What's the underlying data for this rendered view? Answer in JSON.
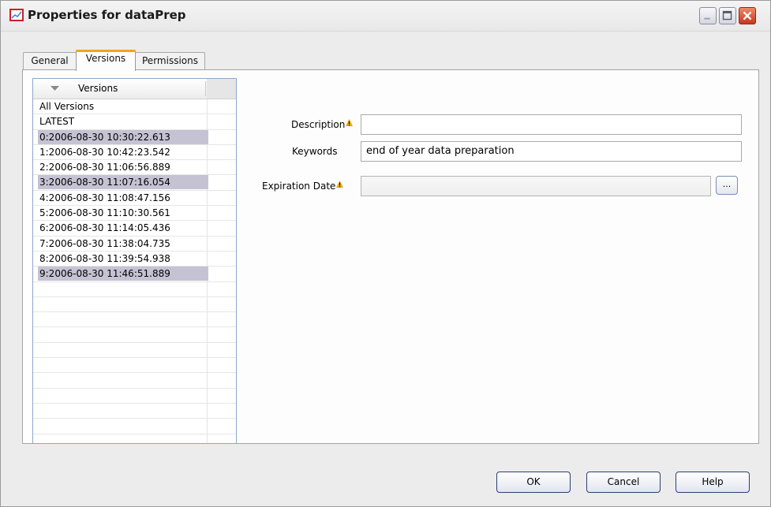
{
  "window": {
    "title": "Properties for dataPrep",
    "controls": {
      "minimize": "minimize-icon",
      "maximize": "maximize-icon",
      "close": "close-icon"
    }
  },
  "tabs": [
    {
      "label": "General"
    },
    {
      "label": "Versions",
      "active": true
    },
    {
      "label": "Permissions"
    }
  ],
  "versions_list": {
    "header": "Versions",
    "rows": [
      {
        "label": "All Versions",
        "selected": false
      },
      {
        "label": "LATEST",
        "selected": false
      },
      {
        "label": "0:2006-08-30 10:30:22.613",
        "selected": true
      },
      {
        "label": "1:2006-08-30 10:42:23.542",
        "selected": false
      },
      {
        "label": "2:2006-08-30 11:06:56.889",
        "selected": false
      },
      {
        "label": "3:2006-08-30 11:07:16.054",
        "selected": true
      },
      {
        "label": "4:2006-08-30 11:08:47.156",
        "selected": false
      },
      {
        "label": "5:2006-08-30 11:10:30.561",
        "selected": false
      },
      {
        "label": "6:2006-08-30 11:14:05.436",
        "selected": false
      },
      {
        "label": "7:2006-08-30 11:38:04.735",
        "selected": false
      },
      {
        "label": "8:2006-08-30 11:39:54.938",
        "selected": false
      },
      {
        "label": "9:2006-08-30 11:46:51.889",
        "selected": true
      },
      {
        "label": "",
        "selected": false
      },
      {
        "label": "",
        "selected": false
      },
      {
        "label": "",
        "selected": false
      },
      {
        "label": "",
        "selected": false
      },
      {
        "label": "",
        "selected": false
      },
      {
        "label": "",
        "selected": false
      },
      {
        "label": "",
        "selected": false
      },
      {
        "label": "",
        "selected": false
      },
      {
        "label": "",
        "selected": false
      },
      {
        "label": "",
        "selected": false
      },
      {
        "label": "",
        "selected": false
      }
    ]
  },
  "form": {
    "description": {
      "label": "Description",
      "value": ""
    },
    "keywords": {
      "label": "Keywords",
      "value": "end of year data preparation"
    },
    "expiration": {
      "label": "Expiration Date",
      "value": "",
      "browse_label": "..."
    }
  },
  "buttons": {
    "ok": "OK",
    "cancel": "Cancel",
    "help": "Help"
  },
  "colors": {
    "accent": "#f2a51e",
    "selection": "#c5c3d3",
    "close_button": "#c8361c",
    "warning": "#e8a800"
  }
}
